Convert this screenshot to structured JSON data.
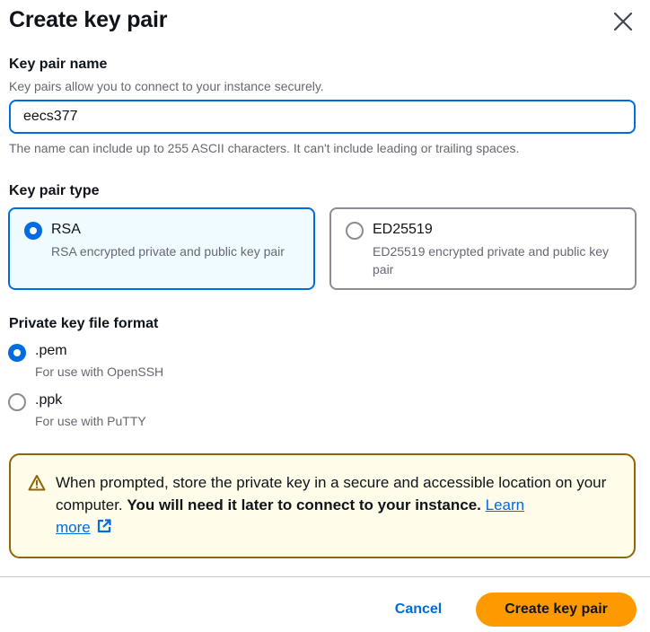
{
  "dialog": {
    "title": "Create key pair",
    "close_icon": "close-icon"
  },
  "key_pair_name": {
    "label": "Key pair name",
    "description": "Key pairs allow you to connect to your instance securely.",
    "value": "eecs377",
    "constraint": "The name can include up to 255 ASCII characters. It can't include leading or trailing spaces."
  },
  "key_pair_type": {
    "label": "Key pair type",
    "options": [
      {
        "title": "RSA",
        "description": "RSA encrypted private and public key pair",
        "selected": true
      },
      {
        "title": "ED25519",
        "description": "ED25519 encrypted private and public key pair",
        "selected": false
      }
    ]
  },
  "file_format": {
    "label": "Private key file format",
    "options": [
      {
        "title": ".pem",
        "description": "For use with OpenSSH",
        "selected": true
      },
      {
        "title": ".ppk",
        "description": "For use with PuTTY",
        "selected": false
      }
    ]
  },
  "alert": {
    "icon": "warning-icon",
    "text": "When prompted, store the private key in a secure and accessible location on your computer. ",
    "bold_text": "You will need it later to connect to your instance.",
    "link_text_1": "Learn",
    "link_text_2": "more",
    "link_icon": "external-link-icon"
  },
  "footer": {
    "cancel_label": "Cancel",
    "create_label": "Create key pair"
  },
  "colors": {
    "accent": "#006ce0",
    "primary_button": "#ff9900",
    "warning_border": "#8d6605",
    "warning_bg": "#fffce9",
    "selected_tile_bg": "#f0fbff"
  }
}
